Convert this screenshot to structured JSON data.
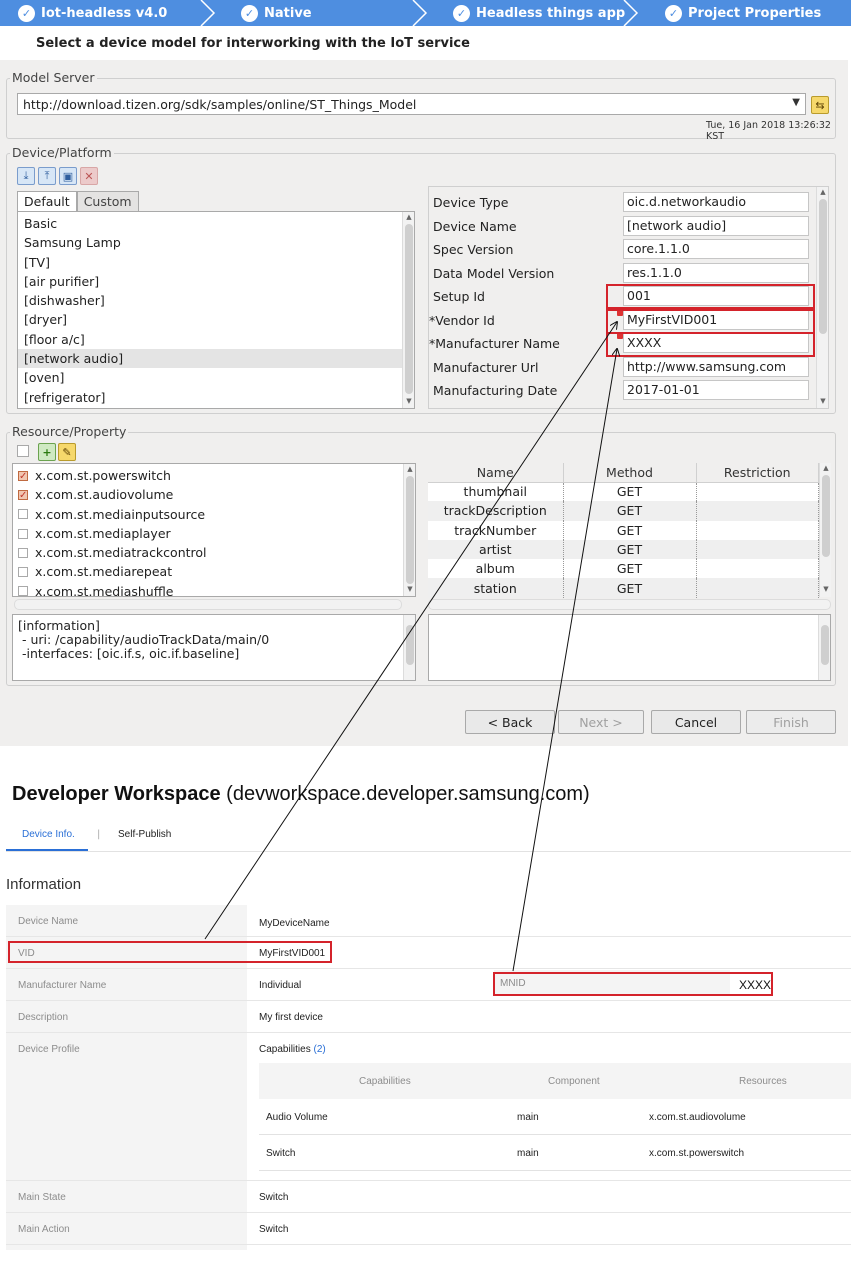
{
  "wizard": {
    "steps": [
      {
        "label": "Iot-headless  v4.0"
      },
      {
        "label": "Native"
      },
      {
        "label": "Headless things app"
      },
      {
        "label": "Project Properties"
      }
    ],
    "title": "Select a device model for interworking with the IoT service",
    "model_server": {
      "legend": "Model Server",
      "url": "http://download.tizen.org/sdk/samples/online/ST_Things_Model",
      "timestamp": "Tue, 16 Jan 2018 13:26:32 KST"
    },
    "device_platform": {
      "legend": "Device/Platform",
      "tabs": [
        "Default",
        "Custom"
      ],
      "models": [
        "Basic",
        "Samsung Lamp",
        "[TV]",
        "[air purifier]",
        "[dishwasher]",
        "[dryer]",
        "[floor a/c]",
        "[network audio]",
        "[oven]",
        "[refrigerator]"
      ],
      "selected_model": "[network audio]",
      "properties": [
        {
          "label": "Device Type",
          "value": "oic.d.networkaudio"
        },
        {
          "label": "Device Name",
          "value": "[network audio]"
        },
        {
          "label": "Spec Version",
          "value": "core.1.1.0"
        },
        {
          "label": "Data Model Version",
          "value": "res.1.1.0"
        },
        {
          "label": "Setup Id",
          "value": "001"
        },
        {
          "label": "*Vendor Id",
          "value": "MyFirstVID001"
        },
        {
          "label": "*Manufacturer Name",
          "value": "XXXX"
        },
        {
          "label": "Manufacturer Url",
          "value": "http://www.samsung.com"
        },
        {
          "label": "Manufacturing Date",
          "value": "2017-01-01"
        }
      ]
    },
    "resource_property": {
      "legend": "Resource/Property",
      "resources": [
        {
          "name": "x.com.st.powerswitch",
          "checked": true
        },
        {
          "name": "x.com.st.audiovolume",
          "checked": true
        },
        {
          "name": "x.com.st.mediainputsource",
          "checked": false
        },
        {
          "name": "x.com.st.mediaplayer",
          "checked": false
        },
        {
          "name": "x.com.st.mediatrackcontrol",
          "checked": false
        },
        {
          "name": "x.com.st.mediarepeat",
          "checked": false
        },
        {
          "name": "x.com.st.mediashuffle",
          "checked": false
        }
      ],
      "columns": [
        "Name",
        "Method",
        "Restriction"
      ],
      "rows": [
        {
          "name": "thumbnail",
          "method": "GET",
          "restriction": ""
        },
        {
          "name": "trackDescription",
          "method": "GET",
          "restriction": ""
        },
        {
          "name": "trackNumber",
          "method": "GET",
          "restriction": ""
        },
        {
          "name": "artist",
          "method": "GET",
          "restriction": ""
        },
        {
          "name": "album",
          "method": "GET",
          "restriction": ""
        },
        {
          "name": "station",
          "method": "GET",
          "restriction": ""
        }
      ],
      "info": "[information]\n - uri: /capability/audioTrackData/main/0\n -interfaces: [oic.if.s, oic.if.baseline]"
    },
    "buttons": {
      "back": "< Back",
      "next": "Next >",
      "cancel": "Cancel",
      "finish": "Finish"
    }
  },
  "workspace": {
    "title_bold": "Developer Workspace",
    "title_rest": " (devworkspace.developer.samsung.com)",
    "tabs": [
      "Device Info.",
      "Self-Publish"
    ],
    "tab_separator": "|",
    "section": "Information",
    "rows": {
      "device_name": {
        "label": "Device Name",
        "value": "MyDeviceName"
      },
      "vid": {
        "label": "VID",
        "value": "MyFirstVID001"
      },
      "manufacturer": {
        "label": "Manufacturer Name",
        "value": "Individual",
        "mnid_label": "MNID",
        "mnid_value": "XXXX"
      },
      "description": {
        "label": "Description",
        "value": "My first device"
      },
      "device_profile": {
        "label": "Device Profile",
        "capabilities_label": "Capabilities",
        "capabilities_count": "(2)"
      },
      "main_state": {
        "label": "Main State",
        "value": "Switch"
      },
      "main_action": {
        "label": "Main Action",
        "value": "Switch"
      }
    },
    "capabilities_table": {
      "headers": [
        "Capabilities",
        "Component",
        "Resources"
      ],
      "rows": [
        {
          "capability": "Audio Volume",
          "component": "main",
          "resource": "x.com.st.audiovolume"
        },
        {
          "capability": "Switch",
          "component": "main",
          "resource": "x.com.st.powerswitch"
        }
      ]
    }
  },
  "colors": {
    "accent": "#4e8ee0",
    "highlight_red": "#d4232b",
    "link_blue": "#2a6fd6"
  }
}
